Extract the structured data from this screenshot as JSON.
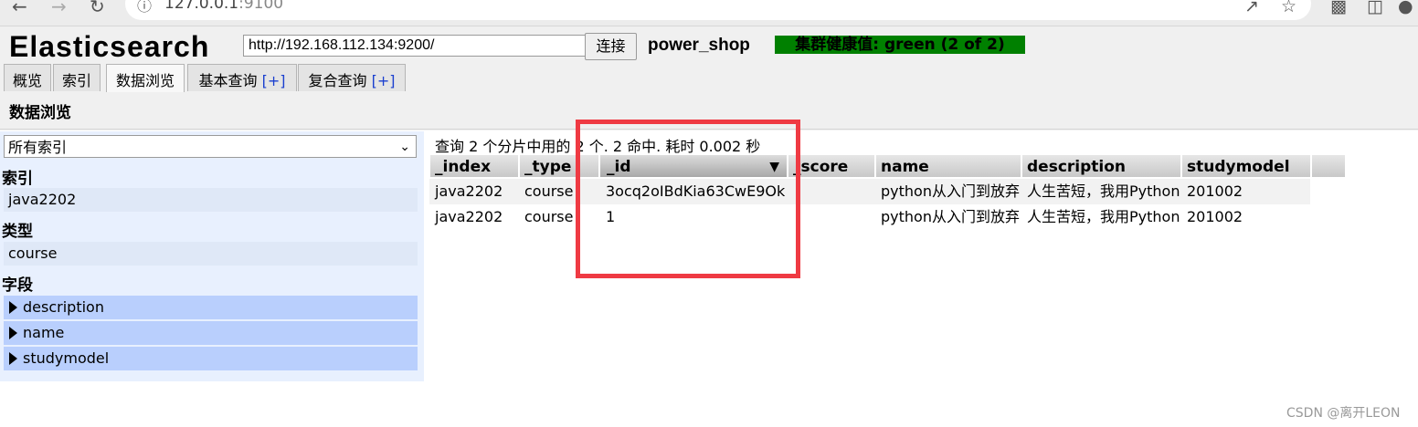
{
  "browser": {
    "url_host": "127.0.0.1",
    "url_port": ":9100",
    "back_icon": "arrow-left-icon",
    "forward_icon": "arrow-right-icon",
    "reload_icon": "reload-icon",
    "info_icon": "info-icon"
  },
  "header": {
    "app_title": "Elasticsearch",
    "connect_url": "http://192.168.112.134:9200/",
    "connect_label": "连接",
    "cluster_name": "power_shop",
    "health_text": "集群健康值: green (2 of 2)",
    "health_color": "#008000"
  },
  "tabs": [
    {
      "label": "概览"
    },
    {
      "label": "索引"
    },
    {
      "label": "数据浏览"
    },
    {
      "label": "基本查询",
      "plus": "[+]"
    },
    {
      "label": "复合查询",
      "plus": "[+]"
    }
  ],
  "section_title": "数据浏览",
  "sidebar": {
    "index_select": "所有索引",
    "index_heading": "索引",
    "index_value": "java2202",
    "type_heading": "类型",
    "type_value": "course",
    "field_heading": "字段",
    "fields": [
      "description",
      "name",
      "studymodel"
    ]
  },
  "results": {
    "summary": "查询 2 个分片中用的 2 个. 2 命中. 耗时 0.002 秒",
    "columns": [
      "_index",
      "_type",
      "_id",
      "_score",
      "name",
      "description",
      "studymodel"
    ],
    "rows": [
      [
        "java2202",
        "course",
        "3ocq2oIBdKia63CwE9Ok",
        "",
        "python从入门到放弃",
        "人生苦短，我用Python",
        "201002"
      ],
      [
        "java2202",
        "course",
        "1",
        "",
        "python从入门到放弃",
        "人生苦短，我用Python",
        "201002"
      ]
    ]
  },
  "highlight_color": "#ef3a43",
  "watermark": "CSDN @离开LEON"
}
